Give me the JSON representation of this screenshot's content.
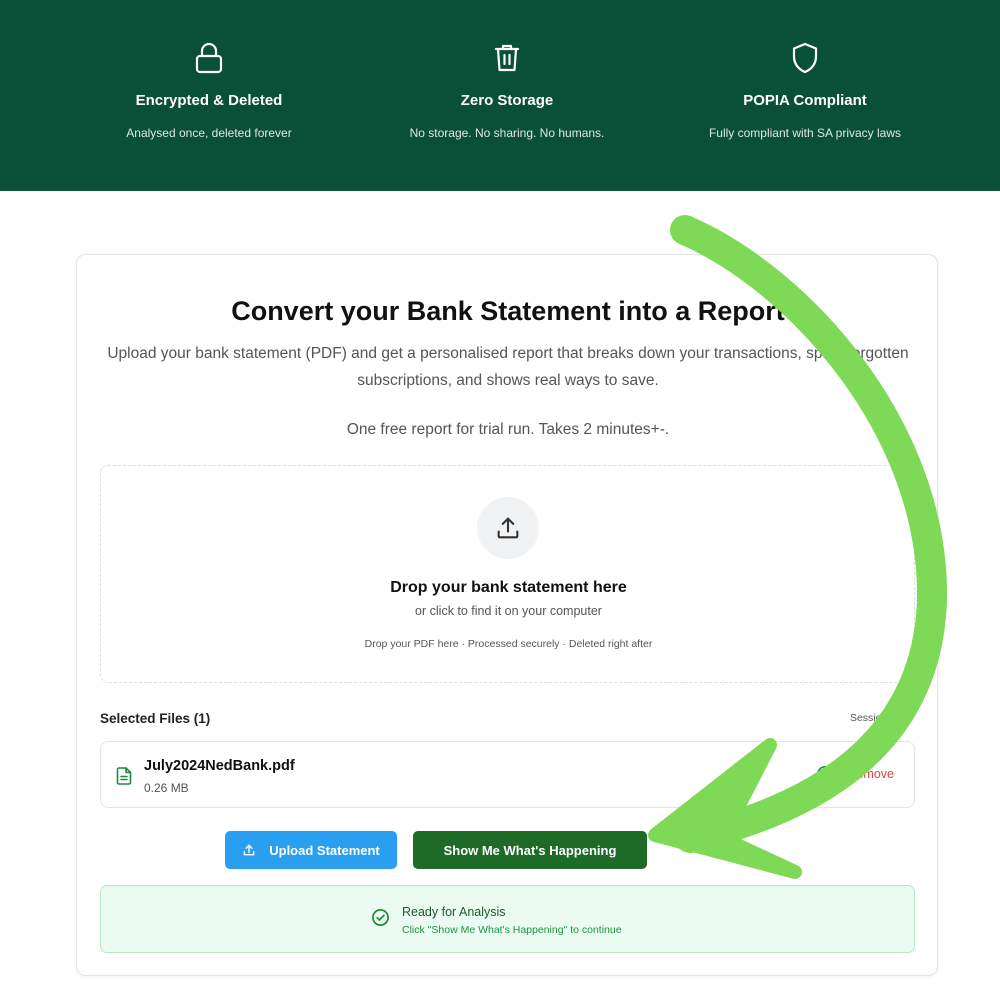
{
  "features": [
    {
      "icon": "lock-icon",
      "title": "Encrypted & Deleted",
      "desc": "Analysed once, deleted forever"
    },
    {
      "icon": "trash-icon",
      "title": "Zero Storage",
      "desc": "No storage. No sharing. No humans."
    },
    {
      "icon": "shield-icon",
      "title": "POPIA Compliant",
      "desc": "Fully compliant with SA privacy laws"
    }
  ],
  "card": {
    "title": "Convert your Bank Statement into a Report",
    "subtitle": "Upload your bank statement (PDF) and get a personalised report that breaks down your transactions, spots forgotten subscriptions, and shows real ways to save.",
    "trial": "One free report for trial run. Takes 2 minutes+-."
  },
  "dropzone": {
    "icon": "upload-icon",
    "title": "Drop your bank statement here",
    "subtitle": "or click to find it on your computer",
    "note": "Drop your PDF here · Processed securely · Deleted right after"
  },
  "files": {
    "heading": "Selected Files (1)",
    "session": "Session: se...",
    "items": [
      {
        "icon": "file-icon",
        "name": "July2024NedBank.pdf",
        "size": "0.26 MB",
        "status_icon": "check-circle-icon",
        "remove_label": "Remove"
      }
    ]
  },
  "actions": {
    "upload_label": "Upload Statement",
    "upload_icon": "upload-icon",
    "show_label": "Show Me What's Happening"
  },
  "status": {
    "icon": "check-circle-icon",
    "title": "Ready for Analysis",
    "subtitle": "Click \"Show Me What's Happening\" to continue"
  },
  "colors": {
    "banner": "#0a5038",
    "upload_button": "#2a9ff0",
    "show_button": "#1d6b26",
    "arrow": "#7ed957",
    "remove_text": "#e04444",
    "ready_bg": "#ecfbf1"
  }
}
